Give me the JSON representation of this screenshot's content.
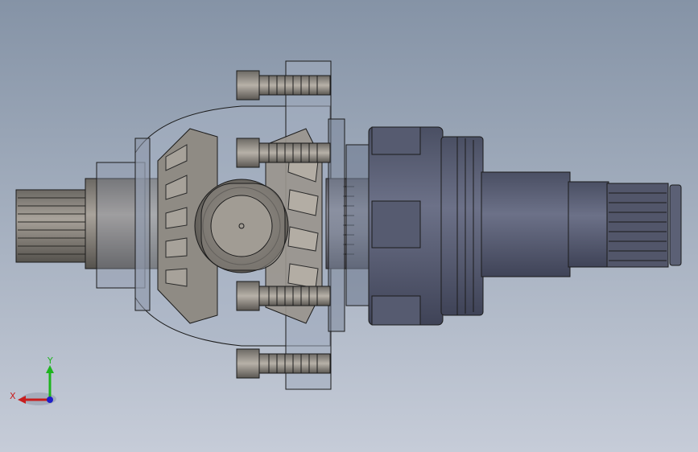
{
  "viewport": {
    "background_top": "#8593a6",
    "background_bottom": "#c6ccd8"
  },
  "model": {
    "shaft_color": "#7d7d8a",
    "housing_color": "#5e6378",
    "gear_color": "#8d8a86",
    "edge_color": "#1b1b1b"
  },
  "triad": {
    "x_label": "X",
    "y_label": "Y",
    "x_color": "#c81e1e",
    "y_color": "#1eb41e",
    "z_color": "#1e1ec8"
  }
}
